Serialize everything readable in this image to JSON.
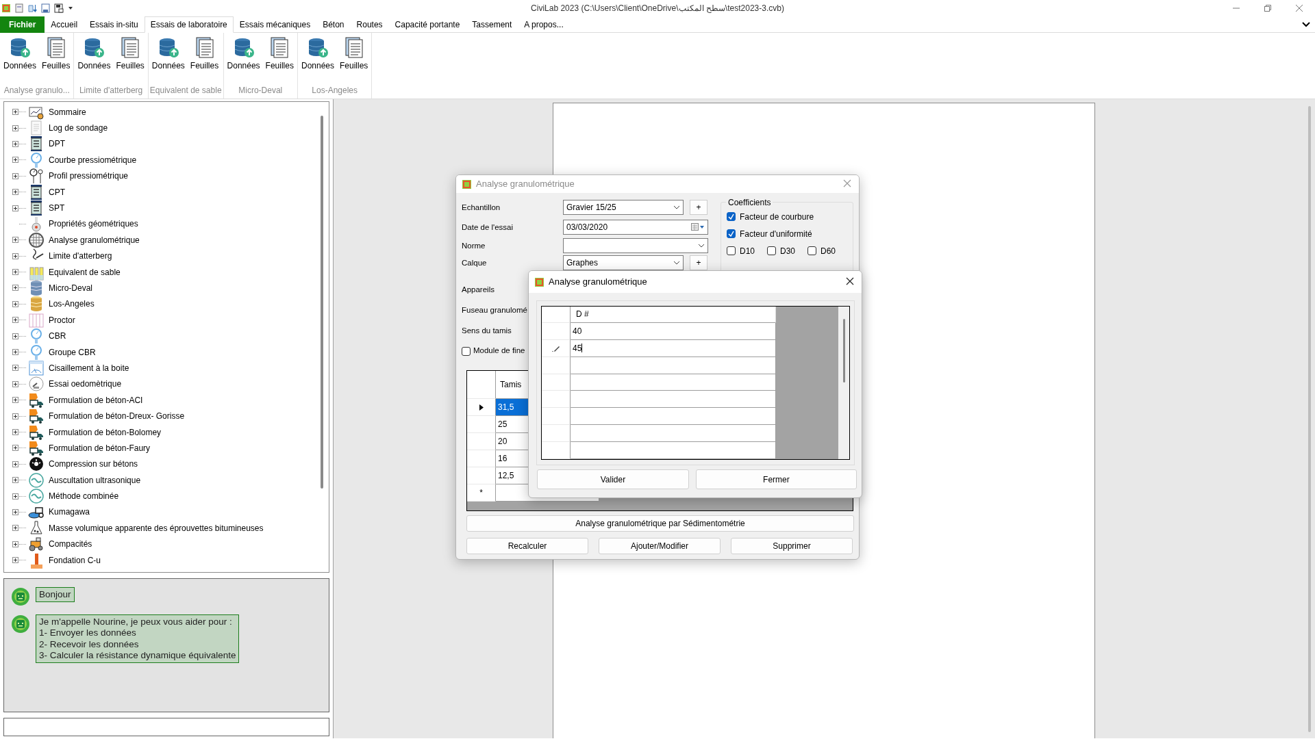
{
  "window": {
    "title": "CiviLab  2023 (C:\\Users\\Client\\OneDrive\\سطح المكتب\\test2023-3.cvb)"
  },
  "ribbon_tabs": [
    {
      "label": "Fichier",
      "kind": "file",
      "selected": false
    },
    {
      "label": "Accueil",
      "kind": "tab",
      "selected": false
    },
    {
      "label": "Essais in-situ",
      "kind": "tab",
      "selected": false
    },
    {
      "label": "Essais de laboratoire",
      "kind": "tab",
      "selected": true
    },
    {
      "label": "Essais mécaniques",
      "kind": "tab",
      "selected": false
    },
    {
      "label": "Béton",
      "kind": "tab",
      "selected": false
    },
    {
      "label": "Routes",
      "kind": "tab",
      "selected": false
    },
    {
      "label": "Capacité portante",
      "kind": "tab",
      "selected": false
    },
    {
      "label": "Tassement",
      "kind": "tab",
      "selected": false
    },
    {
      "label": "A propos...",
      "kind": "tab",
      "selected": false
    }
  ],
  "ribbon_groups": [
    {
      "label": "Analyse granulo...",
      "buttons": [
        {
          "label": "Données",
          "kind": "data"
        },
        {
          "label": "Feuilles",
          "kind": "sheets"
        }
      ]
    },
    {
      "label": "Limite d'atterberg",
      "buttons": [
        {
          "label": "Données",
          "kind": "data"
        },
        {
          "label": "Feuilles",
          "kind": "sheets"
        }
      ]
    },
    {
      "label": "Equivalent de sable",
      "buttons": [
        {
          "label": "Données",
          "kind": "data"
        },
        {
          "label": "Feuilles",
          "kind": "sheets"
        }
      ]
    },
    {
      "label": "Micro-Deval",
      "buttons": [
        {
          "label": "Données",
          "kind": "data"
        },
        {
          "label": "Feuilles",
          "kind": "sheets"
        }
      ]
    },
    {
      "label": "Los-Angeles",
      "buttons": [
        {
          "label": "Données",
          "kind": "data"
        },
        {
          "label": "Feuilles",
          "kind": "sheets"
        }
      ]
    }
  ],
  "tree": [
    {
      "label": "Sommaire",
      "expandable": true
    },
    {
      "label": "Log de sondage",
      "expandable": true
    },
    {
      "label": "DPT",
      "expandable": true
    },
    {
      "label": "Courbe pressiométrique",
      "expandable": true
    },
    {
      "label": "Profil pressiométrique",
      "expandable": true
    },
    {
      "label": "CPT",
      "expandable": true
    },
    {
      "label": "SPT",
      "expandable": true
    },
    {
      "label": "Propriétés géométriques",
      "expandable": false
    },
    {
      "label": "Analyse granulométrique",
      "expandable": true
    },
    {
      "label": "Limite d'atterberg",
      "expandable": true
    },
    {
      "label": "Equivalent de sable",
      "expandable": true
    },
    {
      "label": "Micro-Deval",
      "expandable": true
    },
    {
      "label": "Los-Angeles",
      "expandable": true
    },
    {
      "label": "Proctor",
      "expandable": true
    },
    {
      "label": "CBR",
      "expandable": true
    },
    {
      "label": "Groupe CBR",
      "expandable": true
    },
    {
      "label": "Cisaillement à la boite",
      "expandable": true
    },
    {
      "label": "Essai oedomètrique",
      "expandable": true
    },
    {
      "label": "Formulation de béton-ACI",
      "expandable": true
    },
    {
      "label": "Formulation de béton-Dreux- Gorisse",
      "expandable": true
    },
    {
      "label": "Formulation de béton-Bolomey",
      "expandable": true
    },
    {
      "label": "Formulation de béton-Faury",
      "expandable": true
    },
    {
      "label": "Compression sur bétons",
      "expandable": true
    },
    {
      "label": "Auscultation ultrasonique",
      "expandable": true
    },
    {
      "label": "Méthode combinée",
      "expandable": true
    },
    {
      "label": "Kumagawa",
      "expandable": true
    },
    {
      "label": "Masse volumique apparente des éprouvettes bitumineuses",
      "expandable": true
    },
    {
      "label": "Compacités",
      "expandable": true
    },
    {
      "label": "Fondation C-u",
      "expandable": true
    }
  ],
  "assistant": {
    "messages": [
      "Bonjour",
      "Je m'appelle Nourine, je peux vous aider pour :\n1- Envoyer les données\n2- Recevoir les données\n3- Calculer la résistance dynamique équivalente"
    ]
  },
  "dialog_back": {
    "title": "Analyse granulométrique",
    "active": false,
    "fields": [
      {
        "label": "Echantillon",
        "kind": "combo",
        "value": "Gravier 15/25",
        "add_button": "+"
      },
      {
        "label": "Date de l'essai",
        "kind": "date",
        "value": "03/03/2020"
      },
      {
        "label": "Norme",
        "kind": "combo"
      },
      {
        "label": "Calque",
        "kind": "combo",
        "value": "Graphes",
        "add_button": "+"
      },
      {
        "label": "Appareils",
        "kind": "label"
      },
      {
        "label": "Fuseau granulomé",
        "kind": "label"
      },
      {
        "label": "Sens du tamis",
        "kind": "label"
      },
      {
        "label": "Module de fine",
        "kind": "checkbox",
        "checked": false
      }
    ],
    "coefficients": {
      "title": "Coefficients",
      "checks": [
        {
          "label": "Facteur de courbure",
          "checked": true
        },
        {
          "label": "Facteur d'uniformité",
          "checked": true
        }
      ],
      "d_checks": [
        {
          "label": "D10",
          "checked": false
        },
        {
          "label": "D30",
          "checked": false
        },
        {
          "label": "D60",
          "checked": false
        }
      ]
    },
    "table": {
      "column": "Tamis",
      "new_row_marker": "*",
      "rows": [
        {
          "value": "31,5",
          "selected": true
        },
        {
          "value": "25",
          "selected": false
        },
        {
          "value": "20",
          "selected": false
        },
        {
          "value": "16",
          "selected": false
        },
        {
          "value": "12,5",
          "selected": false
        }
      ]
    },
    "wide_button": "Analyse granulométrique par Sédimentométrie",
    "buttons": [
      "Recalculer",
      "Ajouter/Modifier",
      "Supprimer"
    ]
  },
  "dialog_front": {
    "title": "Analyse granulométrique",
    "active": true,
    "column": "D #",
    "rows": [
      {
        "value": "40",
        "editing": false
      },
      {
        "value": "45",
        "editing": true
      },
      {
        "editing": false
      },
      {
        "editing": false
      },
      {
        "editing": false
      },
      {
        "editing": false
      },
      {
        "editing": false
      },
      {
        "editing": false
      }
    ],
    "buttons": [
      "Valider",
      "Fermer"
    ]
  }
}
